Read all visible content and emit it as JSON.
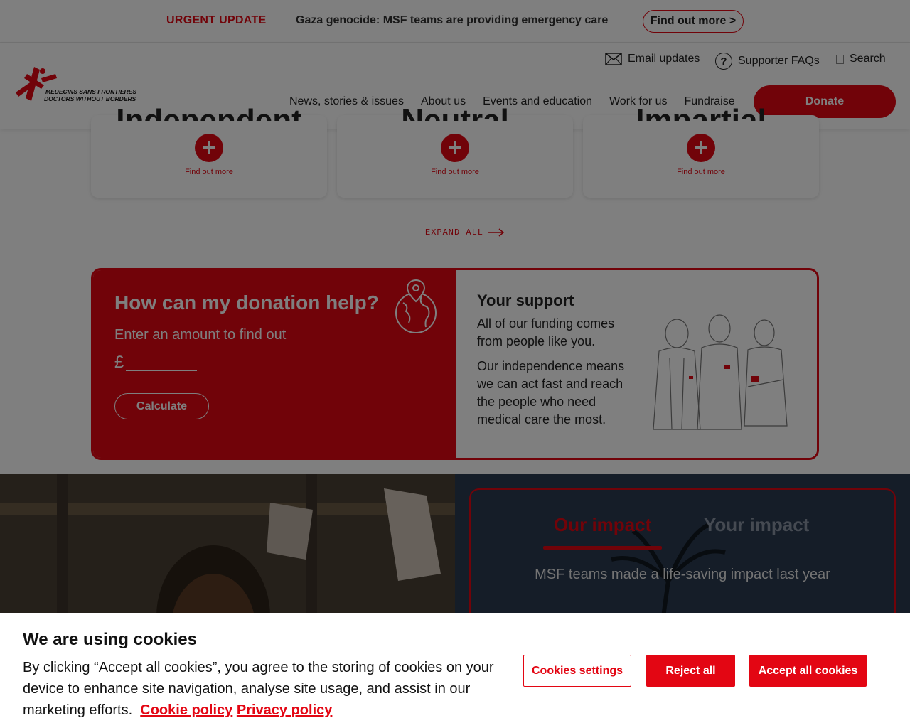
{
  "urgent": {
    "label": "URGENT UPDATE",
    "text": "Gaza genocide: MSF teams are providing emergency care",
    "button": "Find out more >"
  },
  "header": {
    "logo_line1": "MEDECINS SANS FRONTIERES",
    "logo_line2": "DOCTORS WITHOUT BORDERS",
    "email_updates": "Email updates",
    "supporter_faqs": "Supporter FAQs",
    "faq_icon_glyph": "?",
    "search": "Search",
    "nav": [
      "News, stories & issues",
      "About us",
      "Events and education",
      "Work for us",
      "Fundraise"
    ],
    "donate": "Donate"
  },
  "cards": [
    {
      "word": "Independent",
      "plus": "+",
      "link": "Find out more"
    },
    {
      "word": "Neutral",
      "plus": "+",
      "link": "Find out more"
    },
    {
      "word": "Impartial",
      "plus": "+",
      "link": "Find out more"
    }
  ],
  "expand_all": "EXPAND ALL",
  "donation": {
    "title": "How can my donation help?",
    "subtitle": "Enter an amount to find out",
    "currency": "£",
    "calculate": "Calculate",
    "support_title": "Your support",
    "support_p1": "All of our funding comes from people like you.",
    "support_p2": "Our independence means we can act fast and reach the people who need medical care the most."
  },
  "impact": {
    "tab_our": "Our impact",
    "tab_your": "Your impact",
    "text": "MSF teams made a life-saving impact last year"
  },
  "cookie": {
    "title": "We are using cookies",
    "text": "By clicking “Accept all cookies”, you agree to the storing of cookies on your device to enhance site navigation, analyse site usage, and assist in our marketing efforts.",
    "cookie_policy": "Cookie policy",
    "privacy_policy": "Privacy policy",
    "settings": "Cookies settings",
    "reject": "Reject all",
    "accept": "Accept all cookies"
  },
  "colors": {
    "brand_red": "#e30613",
    "overlay": "rgba(0,0,0,0.5)"
  },
  "icons": [
    "msf-logo-icon",
    "mail-icon",
    "question-icon",
    "search-icon",
    "plus-icon",
    "arrow-right-icon",
    "globe-location-icon"
  ]
}
